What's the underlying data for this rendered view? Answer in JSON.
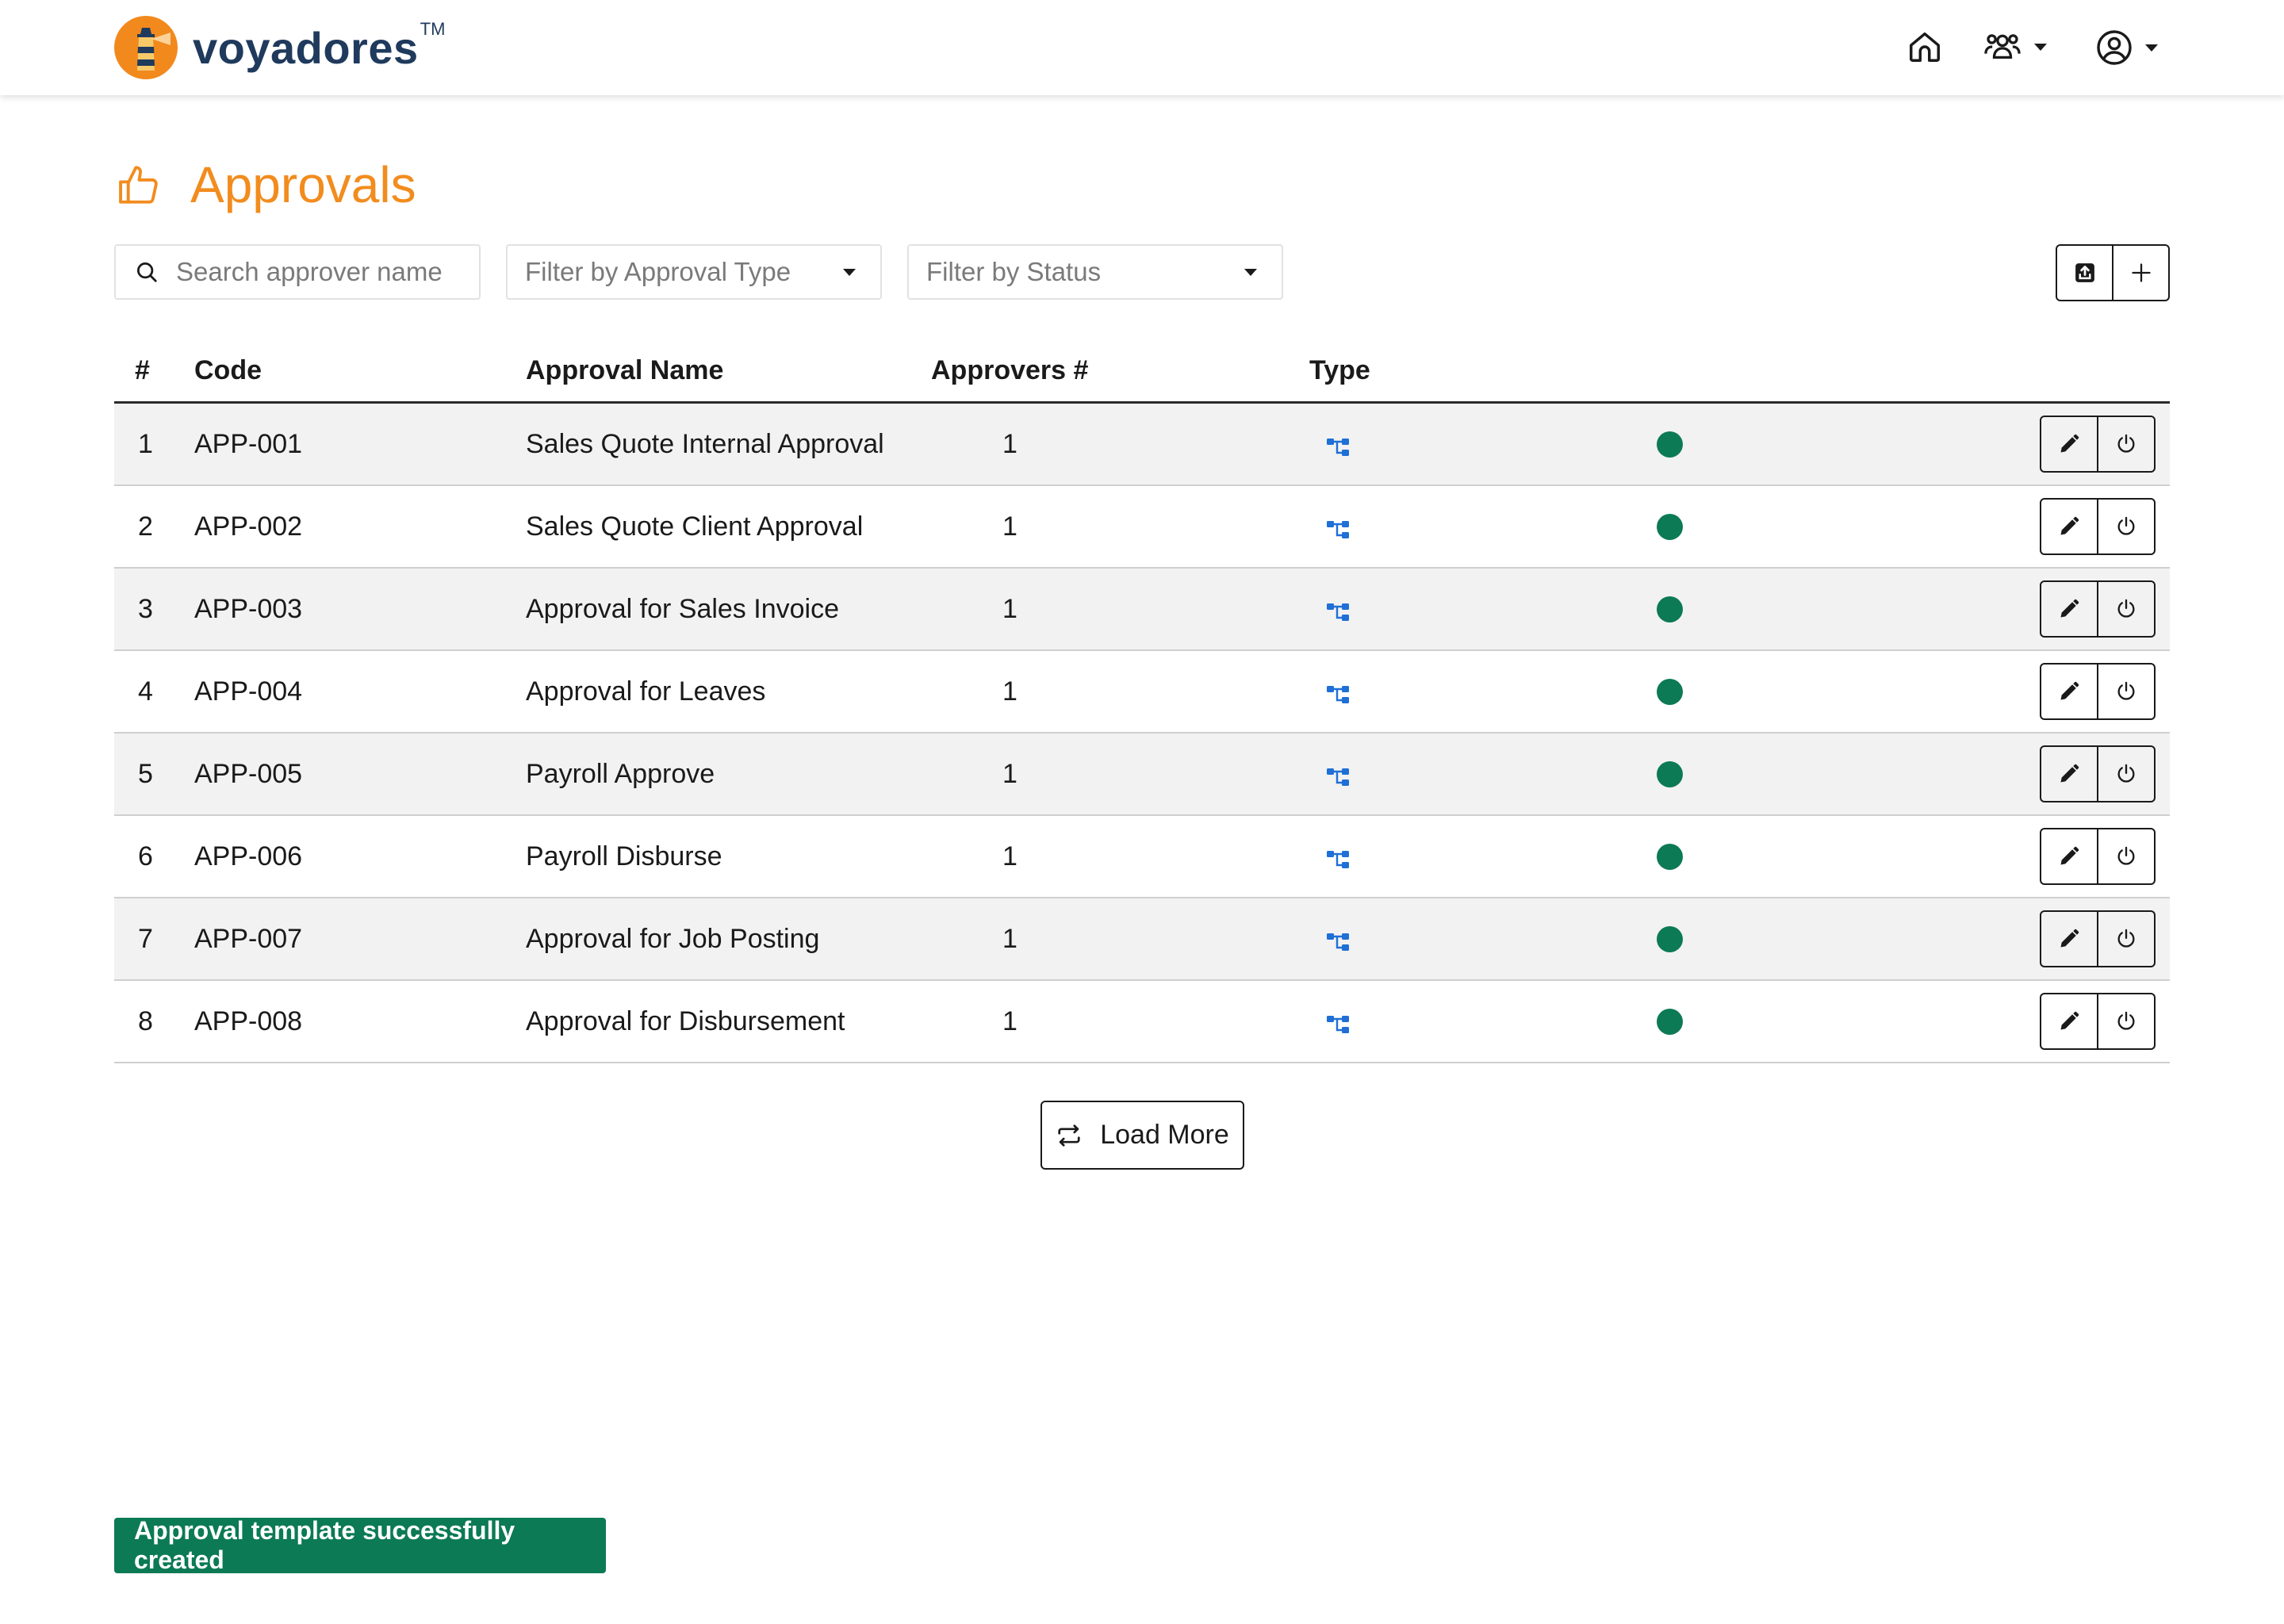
{
  "brand": {
    "name": "voyadores",
    "tm": "TM"
  },
  "page": {
    "title": "Approvals"
  },
  "filters": {
    "search_placeholder": "Search approver name",
    "approval_type_placeholder": "Filter by Approval Type",
    "status_placeholder": "Filter by Status"
  },
  "table": {
    "headers": {
      "num": "#",
      "code": "Code",
      "name": "Approval Name",
      "approvers": "Approvers #",
      "type": "Type"
    },
    "rows": [
      {
        "num": "1",
        "code": "APP-001",
        "name": "Sales Quote Internal Approval",
        "approvers": "1"
      },
      {
        "num": "2",
        "code": "APP-002",
        "name": "Sales Quote Client Approval",
        "approvers": "1"
      },
      {
        "num": "3",
        "code": "APP-003",
        "name": "Approval for Sales Invoice",
        "approvers": "1"
      },
      {
        "num": "4",
        "code": "APP-004",
        "name": "Approval for Leaves",
        "approvers": "1"
      },
      {
        "num": "5",
        "code": "APP-005",
        "name": "Payroll Approve",
        "approvers": "1"
      },
      {
        "num": "6",
        "code": "APP-006",
        "name": "Payroll Disburse",
        "approvers": "1"
      },
      {
        "num": "7",
        "code": "APP-007",
        "name": "Approval for Job Posting",
        "approvers": "1"
      },
      {
        "num": "8",
        "code": "APP-008",
        "name": "Approval for Disbursement",
        "approvers": "1"
      }
    ]
  },
  "load_more": {
    "label": "Load More"
  },
  "toast": {
    "message": "Approval template successfully created"
  },
  "colors": {
    "accent": "#f28c1e",
    "brand": "#1f3a5c",
    "status_active": "#0b7a55",
    "type_icon": "#1f6fd6"
  },
  "icons": {
    "title": "thumbs-up-icon",
    "row_type": "hierarchy-icon",
    "row_edit": "pencil-icon",
    "row_toggle": "power-icon",
    "export": "export-icon",
    "add": "plus-icon",
    "load_more": "repeat-icon"
  }
}
